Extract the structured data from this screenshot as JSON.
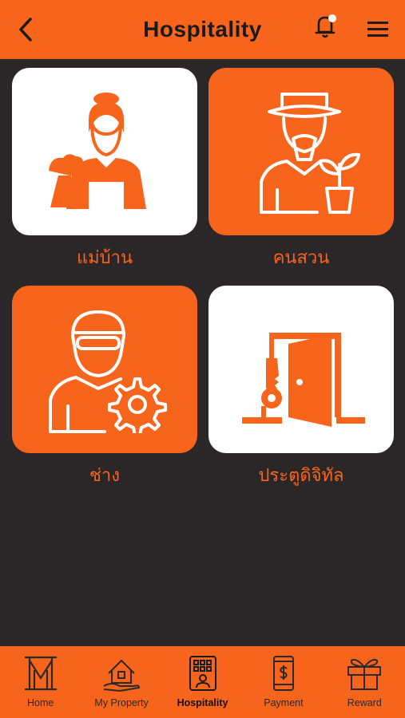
{
  "header": {
    "title": "Hospitality"
  },
  "services": [
    {
      "label": "แม่บ้าน",
      "icon": "housemaid-icon"
    },
    {
      "label": "คนสวน",
      "icon": "gardener-icon"
    },
    {
      "label": "ช่าง",
      "icon": "technician-icon"
    },
    {
      "label": "ประตูดิจิทัล",
      "icon": "digital-door-icon"
    }
  ],
  "tabs": [
    {
      "label": "Home",
      "icon": "home-m-icon"
    },
    {
      "label": "My Property",
      "icon": "property-icon"
    },
    {
      "label": "Hospitality",
      "icon": "hospitality-icon",
      "active": true
    },
    {
      "label": "Payment",
      "icon": "payment-phone-icon"
    },
    {
      "label": "Reward",
      "icon": "gift-icon"
    }
  ],
  "colors": {
    "accent": "#f7641b",
    "background": "#2b2628",
    "tile_white": "#ffffff"
  }
}
